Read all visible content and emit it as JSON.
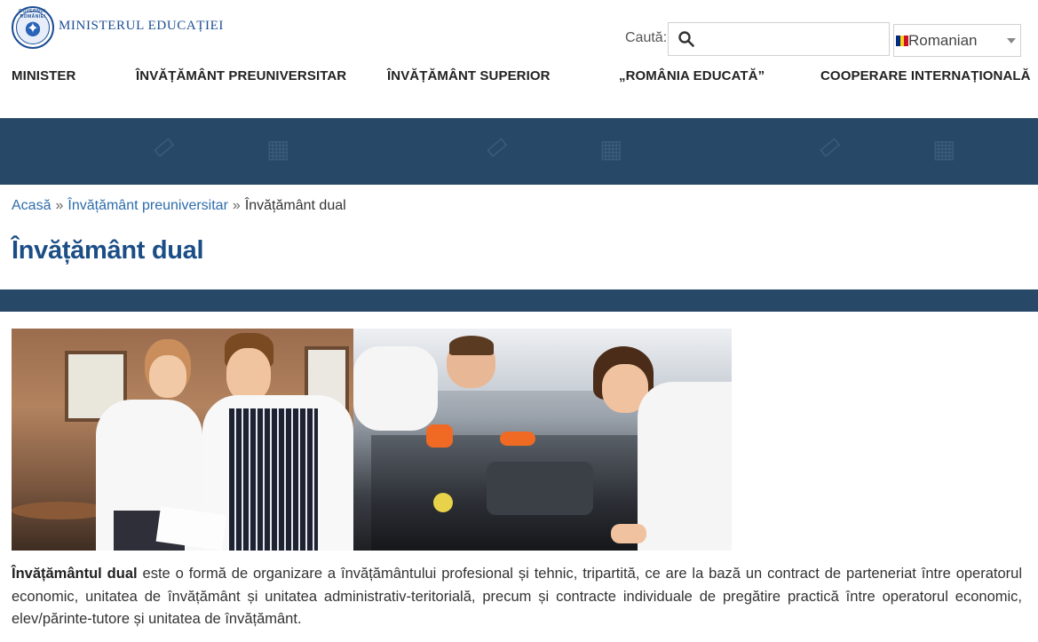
{
  "header": {
    "logo_seal_text": "GUVERNUL ROMÂNIEI",
    "logo_text": "MINISTERUL EDUCAȚIEI",
    "search_label": "Caută:",
    "search_placeholder": "",
    "language_selected": "Romanian",
    "flag_colors": [
      "#002b7f",
      "#fcd116",
      "#ce1126"
    ]
  },
  "nav": {
    "items": [
      {
        "label": "MINISTER"
      },
      {
        "label": "ÎNVĂȚĂMÂNT PREUNIVERSITAR"
      },
      {
        "label": "ÎNVĂȚĂMÂNT SUPERIOR"
      },
      {
        "label": "„ROMÂNIA EDUCATĂ”"
      },
      {
        "label": "COOPERARE INTERNAȚIONALĂ"
      }
    ]
  },
  "breadcrumb": {
    "home": "Acasă",
    "separator": "»",
    "parent": "Învățământ preuniversitar",
    "current": "Învățământ dual"
  },
  "page": {
    "title": "Învățământ dual",
    "intro_bold": "Învățământul dual",
    "intro_rest": " este o formă de organizare a învățământului profesional și tehnic, tripartită, ce are la bază un contract de parteneriat între operatorul economic, unitatea de învățământ și unitatea administrativ-teritorială, precum și contracte individuale de pregătire practică între operatorul economic, elev/părinte-tutore și unitatea de învățământ."
  },
  "colors": {
    "banner": "#274866",
    "title": "#1c4e86",
    "link": "#2e6cab"
  }
}
